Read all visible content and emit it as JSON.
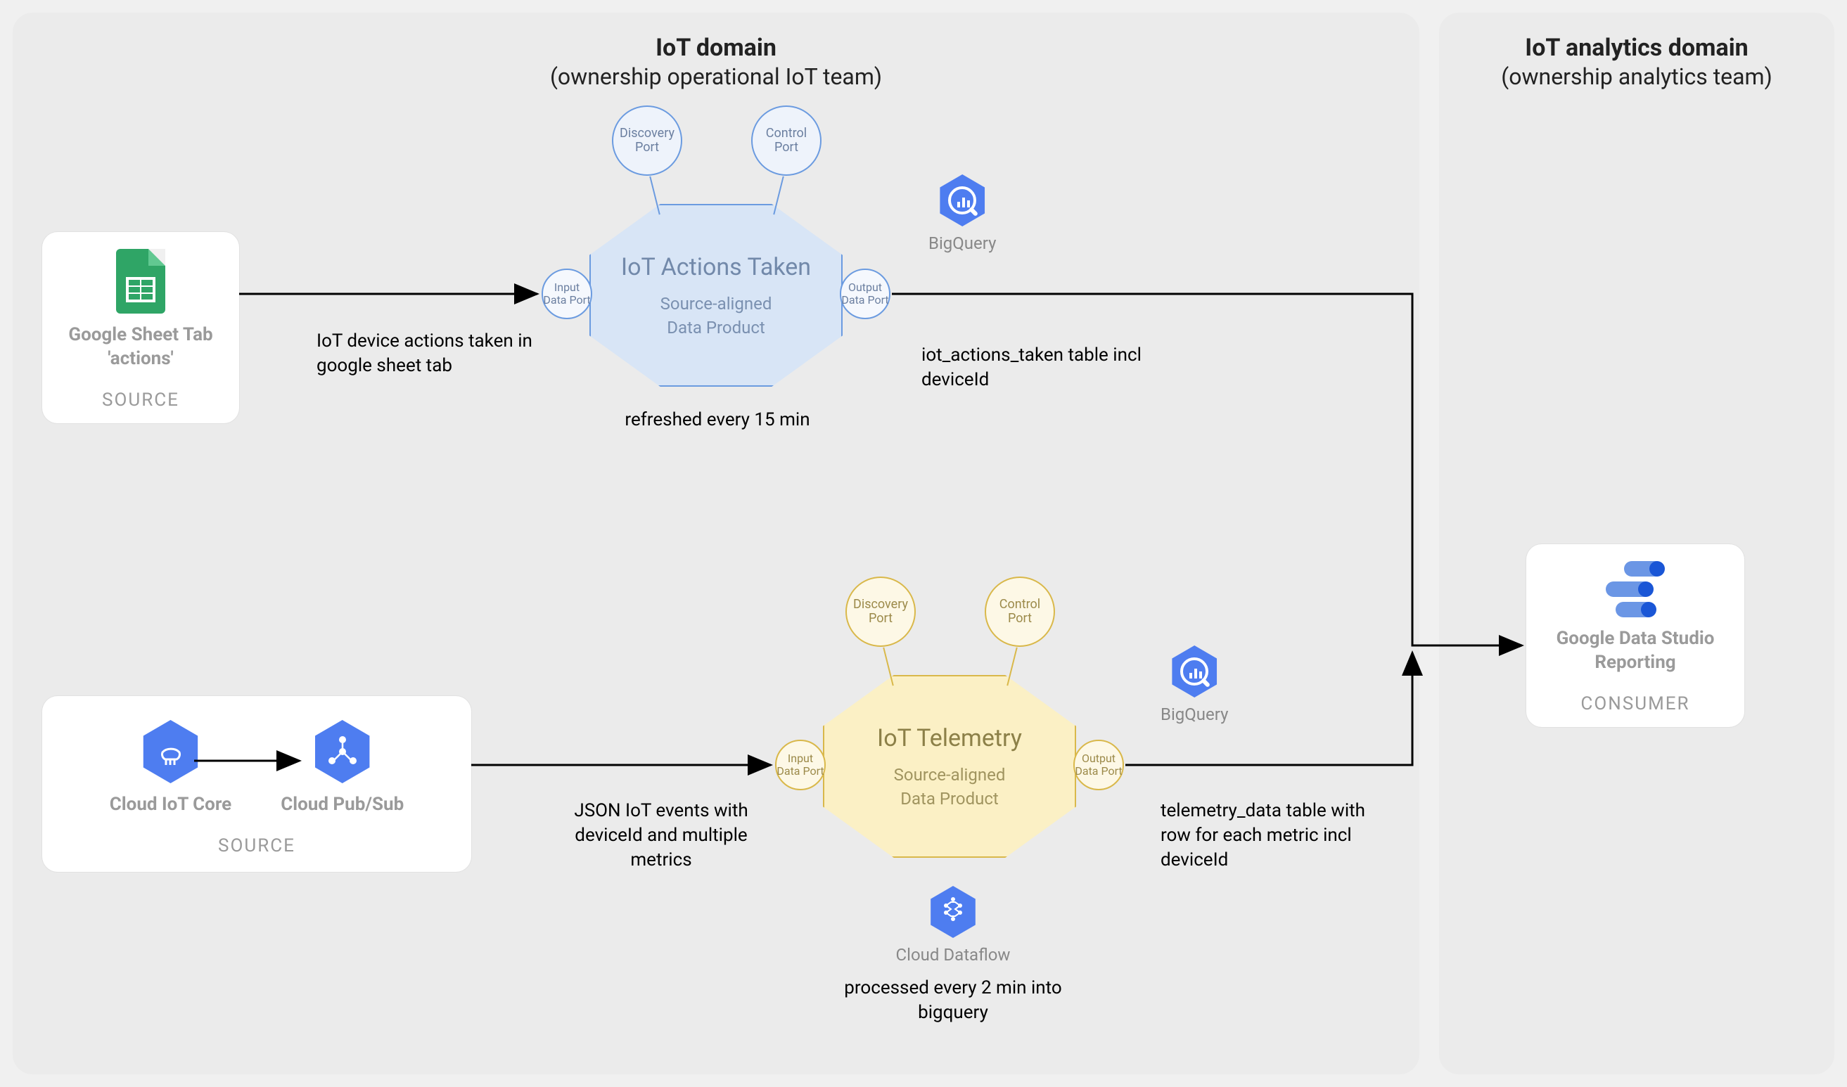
{
  "domains": {
    "iot": {
      "title": "IoT domain",
      "subtitle": "(ownership operational IoT team)"
    },
    "analytics": {
      "title": "IoT analytics domain",
      "subtitle": "(ownership analytics team)"
    }
  },
  "sources": {
    "sheets": {
      "label": "Google Sheet Tab 'actions'",
      "role": "SOURCE"
    },
    "iotcore": {
      "label": "Cloud IoT Core"
    },
    "pubsub": {
      "label": "Cloud Pub/Sub"
    },
    "bottomRole": "SOURCE"
  },
  "products": {
    "actions": {
      "title": "IoT Actions Taken",
      "line1": "Source-aligned",
      "line2": "Data Product",
      "refresh": "refreshed every 15 min",
      "ports": {
        "input": "Input Data Port",
        "output": "Output Data Port",
        "discovery": "Discovery Port",
        "control": "Control Port"
      }
    },
    "telemetry": {
      "title": "IoT Telemetry",
      "line1": "Source-aligned",
      "line2": "Data Product",
      "ports": {
        "input": "Input Data Port",
        "output": "Output Data Port",
        "discovery": "Discovery Port",
        "control": "Control Port"
      }
    }
  },
  "services": {
    "bigquery1": "BigQuery",
    "bigquery2": "BigQuery",
    "dataflow": {
      "name": "Cloud Dataflow",
      "note": "processed every 2 min into bigquery"
    }
  },
  "annotations": {
    "a1": "IoT device actions taken in google sheet tab",
    "a2": "iot_actions_taken table incl deviceId",
    "a3": "JSON IoT events with deviceId and multiple metrics",
    "a4": "telemetry_data table with row for each metric incl deviceId"
  },
  "consumer": {
    "label": "Google Data Studio Reporting",
    "role": "CONSUMER"
  }
}
